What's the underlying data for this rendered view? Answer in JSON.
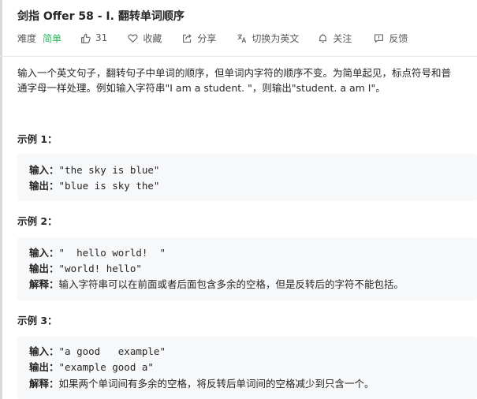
{
  "problem": {
    "title": "剑指 Offer 58 - I. 翻转单词顺序",
    "difficulty_label": "难度",
    "difficulty_value": "简单",
    "like_count": "31",
    "favorite_label": "收藏",
    "share_label": "分享",
    "switch_lang_label": "切换为英文",
    "follow_label": "关注",
    "feedback_label": "反馈"
  },
  "description": {
    "line1": "输入一个英文句子，翻转句子中单词的顺序，但单词内字符的顺序不变。为简单起见，标点符号和普",
    "line2": "通字母一样处理。例如输入字符串\"I am a student. \"，则输出\"student. a am I\"。"
  },
  "examples": [
    {
      "title": "示例 1：",
      "input_key": "输入：",
      "input_value": "\"the sky is blue\"",
      "output_key": "输出：",
      "output_value": "\"blue is sky the\""
    },
    {
      "title": "示例 2：",
      "input_key": "输入：",
      "input_value": "\"  hello world!  \"",
      "output_key": "输出：",
      "output_value": "\"world! hello\"",
      "explain_key": "解释：",
      "explain_value": "输入字符串可以在前面或者后面包含多余的空格，但是反转后的字符不能包括。"
    },
    {
      "title": "示例 3：",
      "input_key": "输入：",
      "input_value": "\"a good   example\"",
      "output_key": "输出：",
      "output_value": "\"example good a\"",
      "explain_key": "解释：",
      "explain_value": "如果两个单词间有多余的空格，将反转后单词间的空格减少到只含一个。"
    }
  ],
  "colors": {
    "difficulty_easy": "#2db55d",
    "example_bg": "#f7f8fa"
  },
  "icons": [
    "thumbs-up-icon",
    "heart-icon",
    "share-icon",
    "translate-icon",
    "bell-icon",
    "feedback-icon"
  ]
}
